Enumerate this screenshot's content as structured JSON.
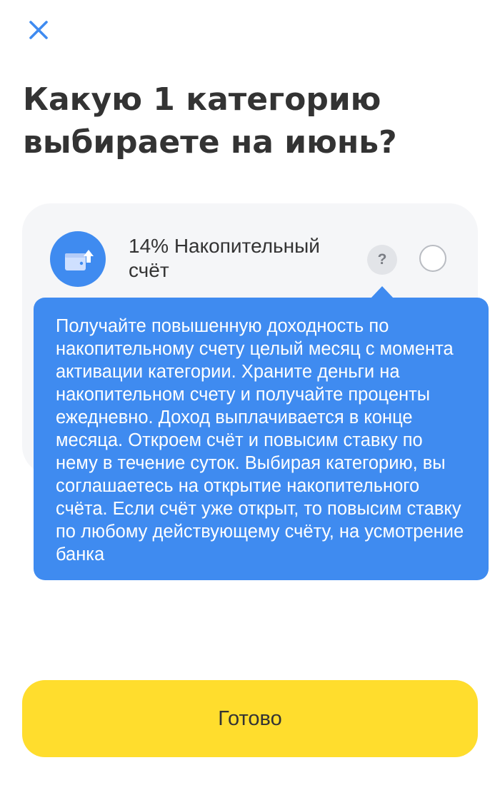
{
  "header": {
    "close_icon": "close-icon",
    "title": "Какую 1 категорию выбираете на июнь?"
  },
  "category": {
    "icon": "wallet-arrow-up-icon",
    "label": "14% Накопительный счёт",
    "help_label": "?"
  },
  "tooltip": {
    "text": "Получайте повышенную доходность по накопительному счету целый месяц с момента активации категории. Храните деньги на накопительном счету и получайте проценты ежедневно. Доход выплачивается в конце месяца. Откроем счёт и повысим ставку по нему в течение суток. Выбирая категорию, вы соглашаетесь на открытие накопительного счёта. Если счёт уже открыт, то повысим ставку по любому действующему счёту, на усмотрение банка"
  },
  "footer": {
    "done_label": "Готово"
  },
  "colors": {
    "accent_blue": "#3f8bf0",
    "button_yellow": "#ffdd2d",
    "card_bg": "#f5f6f8"
  }
}
